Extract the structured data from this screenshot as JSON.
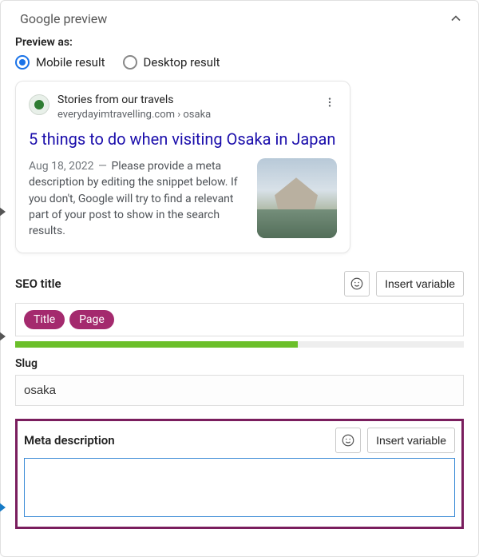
{
  "header": {
    "title": "Google preview"
  },
  "preview": {
    "label": "Preview as:",
    "options": {
      "mobile": "Mobile result",
      "desktop": "Desktop result"
    },
    "selected": "mobile"
  },
  "serp": {
    "site_name": "Stories from our travels",
    "breadcrumb": "everydayimtravelling.com › osaka",
    "title": "5 things to do when visiting Osaka in Japan",
    "date": "Aug 18, 2022",
    "dash": "—",
    "description": "Please provide a meta description by editing the snippet below. If you don't, Google will try to find a relevant part of your post to show in the search results."
  },
  "seo_title": {
    "label": "SEO title",
    "pills": [
      "Title",
      "Page"
    ],
    "insert_variable": "Insert variable"
  },
  "slug": {
    "label": "Slug",
    "value": "osaka"
  },
  "meta": {
    "label": "Meta description",
    "insert_variable": "Insert variable",
    "value": ""
  }
}
